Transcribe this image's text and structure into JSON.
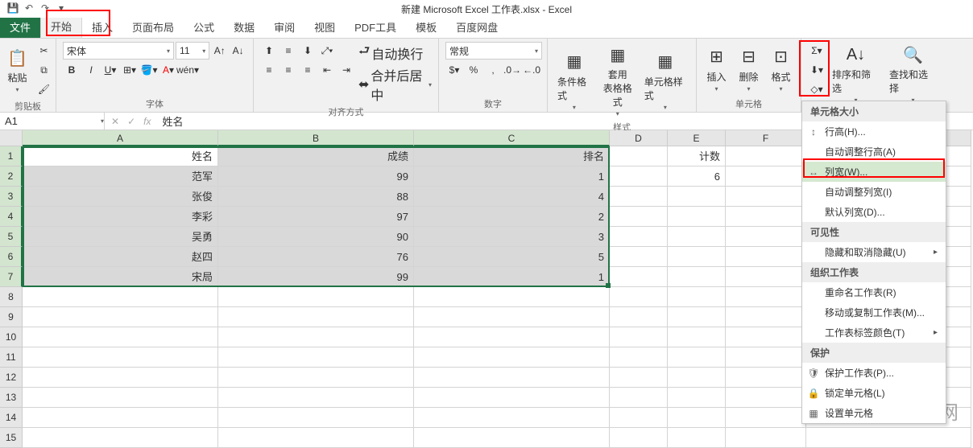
{
  "title": "新建 Microsoft Excel 工作表.xlsx - Excel",
  "tabs": {
    "file": "文件",
    "home": "开始",
    "insert": "插入",
    "layout": "页面布局",
    "formula": "公式",
    "data": "数据",
    "review": "审阅",
    "view": "视图",
    "pdf": "PDF工具",
    "template": "模板",
    "baidu": "百度网盘"
  },
  "ribbon": {
    "clipboard": {
      "paste": "粘贴",
      "label": "剪贴板"
    },
    "font": {
      "name": "宋体",
      "size": "11",
      "label": "字体"
    },
    "alignment": {
      "wrap": "自动换行",
      "merge": "合并后居中",
      "label": "对齐方式"
    },
    "number": {
      "format": "常规",
      "label": "数字"
    },
    "styles": {
      "condfmt": "条件格式",
      "table": "套用\n表格格式",
      "cellstyle": "单元格样式",
      "label": "样式"
    },
    "cells": {
      "insert": "插入",
      "delete": "删除",
      "format": "格式",
      "label": "单元格"
    },
    "editing": {
      "sort": "排序和筛选",
      "find": "查找和选择",
      "label": "编辑"
    }
  },
  "namebox": "A1",
  "formula": "姓名",
  "columns": [
    "A",
    "B",
    "C",
    "D",
    "E",
    "F"
  ],
  "data_rows": [
    {
      "r": "1",
      "a": "姓名",
      "b": "成绩",
      "c": "排名",
      "d": "",
      "e": "计数",
      "f": ""
    },
    {
      "r": "2",
      "a": "范军",
      "b": "99",
      "c": "1",
      "d": "",
      "e": "6",
      "f": ""
    },
    {
      "r": "3",
      "a": "张俊",
      "b": "88",
      "c": "4",
      "d": "",
      "e": "",
      "f": ""
    },
    {
      "r": "4",
      "a": "李彩",
      "b": "97",
      "c": "2",
      "d": "",
      "e": "",
      "f": ""
    },
    {
      "r": "5",
      "a": "吴勇",
      "b": "90",
      "c": "3",
      "d": "",
      "e": "",
      "f": ""
    },
    {
      "r": "6",
      "a": "赵四",
      "b": "76",
      "c": "5",
      "d": "",
      "e": "",
      "f": ""
    },
    {
      "r": "7",
      "a": "宋局",
      "b": "99",
      "c": "1",
      "d": "",
      "e": "",
      "f": ""
    }
  ],
  "empty_rows": [
    "8",
    "9",
    "10",
    "11",
    "12",
    "13",
    "14",
    "15"
  ],
  "format_menu": {
    "sec_size": "单元格大小",
    "row_h": "行高(H)...",
    "auto_row": "自动调整行高(A)",
    "col_w": "列宽(W)...",
    "auto_col": "自动调整列宽(I)",
    "def_col": "默认列宽(D)...",
    "sec_vis": "可见性",
    "hide": "隐藏和取消隐藏(U)",
    "sec_org": "组织工作表",
    "rename": "重命名工作表(R)",
    "move": "移动或复制工作表(M)...",
    "tabcolor": "工作表标签颜色(T)",
    "sec_prot": "保护",
    "protect": "保护工作表(P)...",
    "lock": "锁定单元格(L)",
    "cellfmt": "设置单元格"
  },
  "watermark": "河南龙网"
}
